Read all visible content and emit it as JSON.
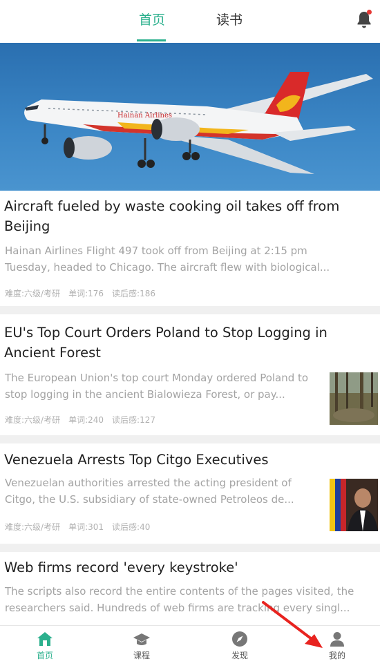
{
  "header": {
    "tabs": [
      "首页",
      "读书"
    ],
    "active_tab": "首页"
  },
  "articles": [
    {
      "title": "Aircraft fueled by waste cooking oil takes off from Beijing",
      "summary": "Hainan Airlines Flight 497 took off from Beijing at 2:15 pm Tuesday, headed to Chicago. The aircraft flew with biological...",
      "difficulty": "难度:六级/考研",
      "words": "单词:176",
      "reads": "读后感:186"
    },
    {
      "title": "EU's Top Court Orders Poland to Stop Logging in Ancient Forest",
      "summary": "The European Union's top court Monday ordered Poland to stop logging in the ancient Bialowieza Forest, or pay...",
      "difficulty": "难度:六级/考研",
      "words": "单词:240",
      "reads": "读后感:127"
    },
    {
      "title": "Venezuela Arrests Top Citgo Executives",
      "summary": "Venezuelan authorities arrested the acting president of Citgo, the U.S. subsidiary of state-owned Petroleos de...",
      "difficulty": "难度:六级/考研",
      "words": "单词:301",
      "reads": "读后感:40"
    },
    {
      "title": "Web firms record 'every keystroke'",
      "summary": "The scripts also record the entire contents of the pages visited, the researchers said. Hundreds of web firms are tracking every singl..."
    }
  ],
  "hero_image": {
    "livery_text": "Hainan Airlines"
  },
  "bottom_nav": [
    {
      "label": "首页",
      "icon": "home-icon"
    },
    {
      "label": "课程",
      "icon": "graduation-cap-icon"
    },
    {
      "label": "发现",
      "icon": "compass-icon"
    },
    {
      "label": "我的",
      "icon": "user-icon"
    }
  ],
  "colors": {
    "accent": "#2bb08d",
    "notification_dot": "#e53935",
    "annotation_arrow": "#e8231f"
  }
}
